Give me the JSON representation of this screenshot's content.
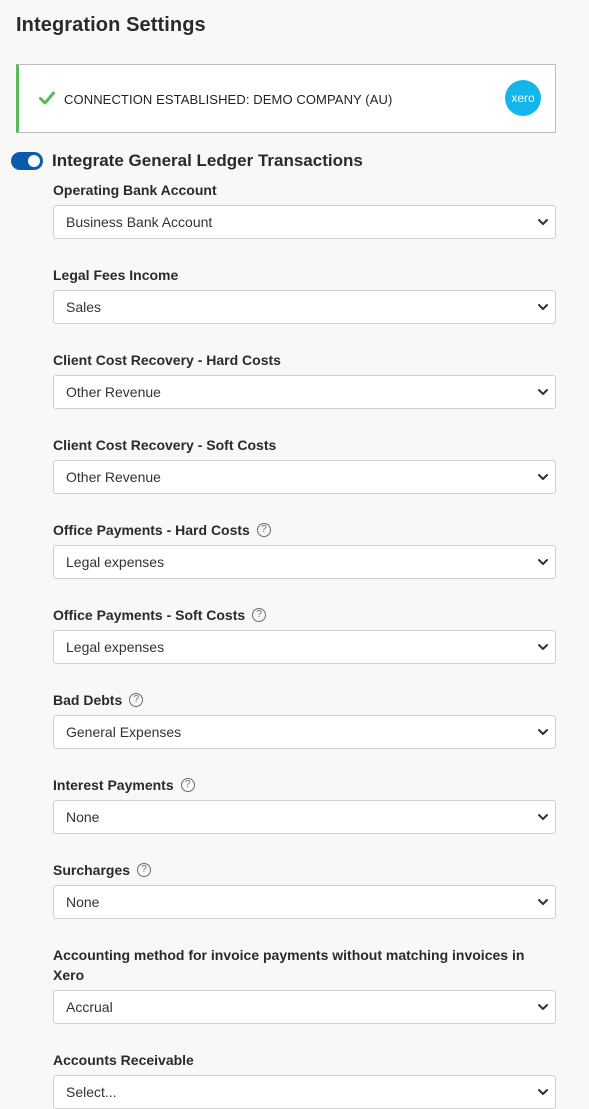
{
  "page": {
    "title": "Integration Settings"
  },
  "connection": {
    "status_label": "CONNECTION ESTABLISHED:",
    "company": "DEMO COMPANY (AU)",
    "logo_text": "xero",
    "check_icon": "checkmark-icon",
    "accent_color": "#5cb85c",
    "logo_color": "#13b5ea"
  },
  "integrate_gl": {
    "label": "Integrate General Ledger Transactions",
    "enabled": true,
    "toggle_color": "#0b5cad"
  },
  "fields": [
    {
      "label": "Operating Bank Account",
      "value": "Business Bank Account",
      "help": false
    },
    {
      "label": "Legal Fees Income",
      "value": "Sales",
      "help": false
    },
    {
      "label": "Client Cost Recovery - Hard Costs",
      "value": "Other Revenue",
      "help": false
    },
    {
      "label": "Client Cost Recovery - Soft Costs",
      "value": "Other Revenue",
      "help": false
    },
    {
      "label": "Office Payments - Hard Costs",
      "value": "Legal expenses",
      "help": true
    },
    {
      "label": "Office Payments - Soft Costs",
      "value": "Legal expenses",
      "help": true
    },
    {
      "label": "Bad Debts",
      "value": "General Expenses",
      "help": true
    },
    {
      "label": "Interest Payments",
      "value": "None",
      "help": true
    },
    {
      "label": "Surcharges",
      "value": "None",
      "help": true
    },
    {
      "label": "Accounting method for invoice payments without matching invoices in Xero",
      "value": "Accrual",
      "help": false
    },
    {
      "label": "Accounts Receivable",
      "value": "Select...",
      "help": false
    }
  ],
  "help_icon_glyph": "?"
}
